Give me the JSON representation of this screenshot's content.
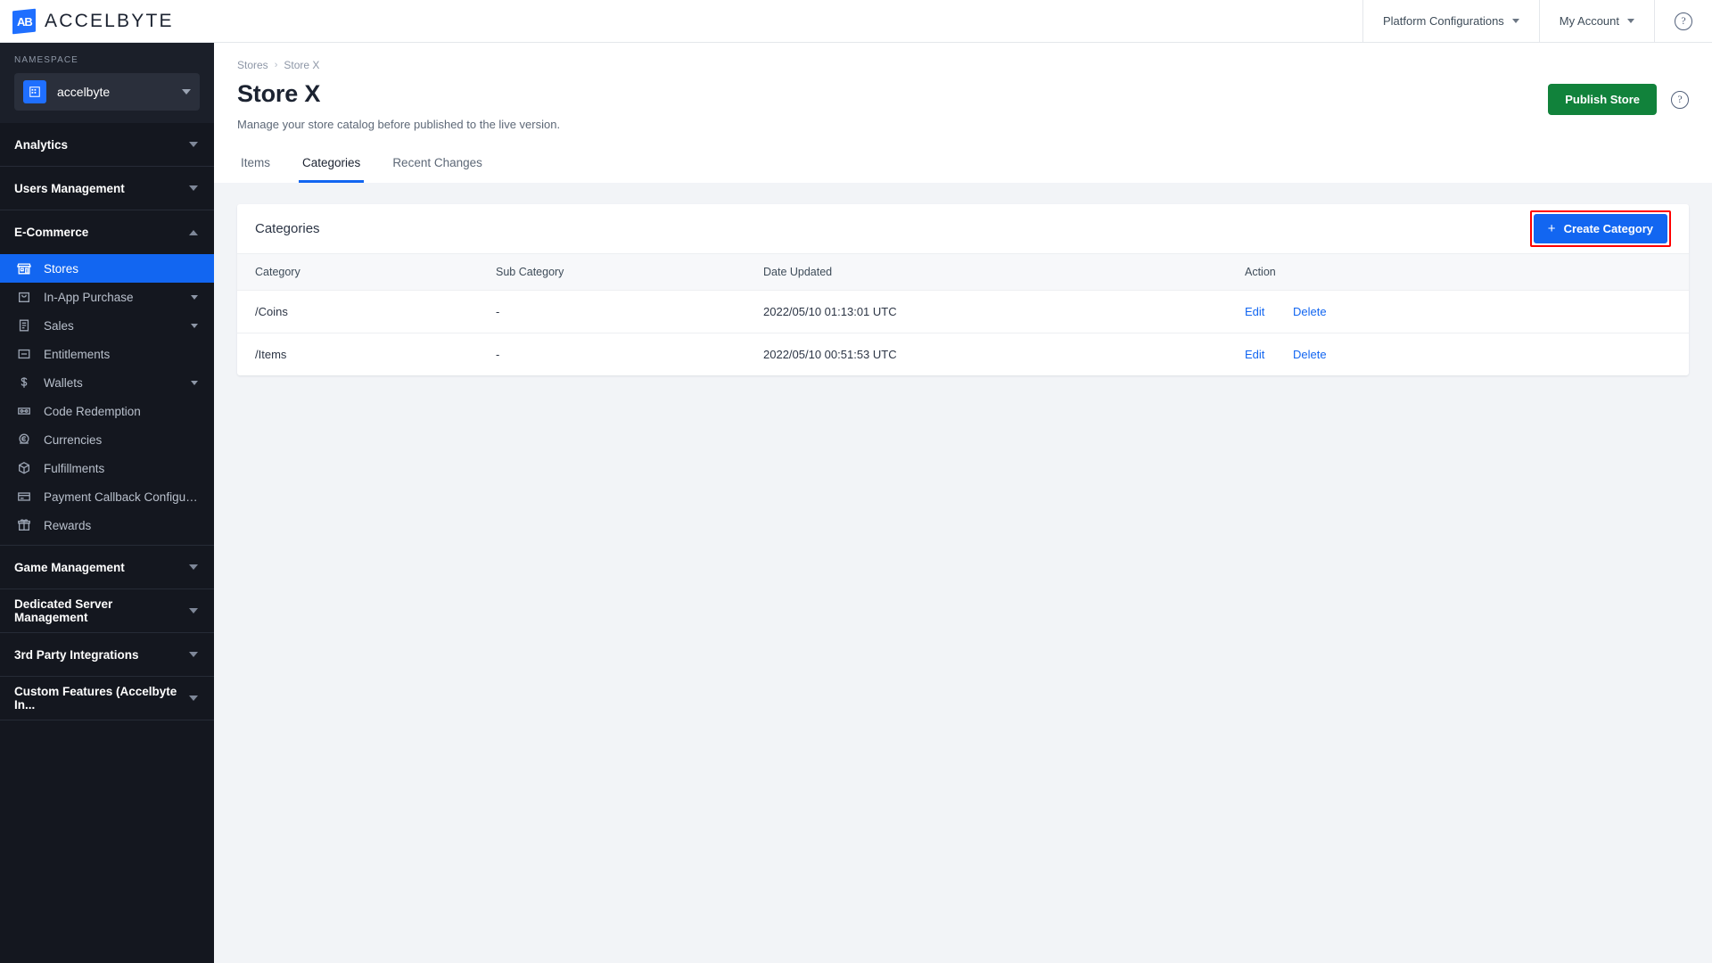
{
  "topbar": {
    "brand_mark": "AB",
    "brand_text": "ACCELBYTE",
    "platform_configurations": "Platform Configurations",
    "my_account": "My Account",
    "help_glyph": "?"
  },
  "sidebar": {
    "namespace_label": "NAMESPACE",
    "namespace_value": "accelbyte",
    "sections": [
      {
        "label": "Analytics",
        "expanded": false
      },
      {
        "label": "Users Management",
        "expanded": false
      },
      {
        "label": "E-Commerce",
        "expanded": true
      },
      {
        "label": "Game Management",
        "expanded": false
      },
      {
        "label": "Dedicated Server Management",
        "expanded": false
      },
      {
        "label": "3rd Party Integrations",
        "expanded": false
      },
      {
        "label": "Custom Features (Accelbyte In...",
        "expanded": false
      }
    ],
    "ecommerce_items": [
      {
        "label": "Stores",
        "icon": "store-icon",
        "active": true,
        "chevron": false
      },
      {
        "label": "In-App Purchase",
        "icon": "shopping-bag-icon",
        "active": false,
        "chevron": true
      },
      {
        "label": "Sales",
        "icon": "receipt-icon",
        "active": false,
        "chevron": true
      },
      {
        "label": "Entitlements",
        "icon": "card-icon",
        "active": false,
        "chevron": false
      },
      {
        "label": "Wallets",
        "icon": "dollar-icon",
        "active": false,
        "chevron": true
      },
      {
        "label": "Code Redemption",
        "icon": "ticket-icon",
        "active": false,
        "chevron": false
      },
      {
        "label": "Currencies",
        "icon": "coin-icon",
        "active": false,
        "chevron": false
      },
      {
        "label": "Fulfillments",
        "icon": "box-icon",
        "active": false,
        "chevron": false
      },
      {
        "label": "Payment Callback Configuration",
        "icon": "payment-card-icon",
        "active": false,
        "chevron": false
      },
      {
        "label": "Rewards",
        "icon": "gift-icon",
        "active": false,
        "chevron": false
      }
    ]
  },
  "page": {
    "breadcrumb": [
      "Stores",
      "Store X"
    ],
    "breadcrumb_separator": "›",
    "title": "Store X",
    "subtitle": "Manage your store catalog before published to the live version.",
    "publish_button": "Publish Store",
    "help_glyph": "?",
    "tabs": [
      {
        "label": "Items",
        "active": false
      },
      {
        "label": "Categories",
        "active": true
      },
      {
        "label": "Recent Changes",
        "active": false
      }
    ]
  },
  "categories_card": {
    "title": "Categories",
    "create_button": "Create Category",
    "create_button_plus": "+",
    "columns": [
      "Category",
      "Sub Category",
      "Date Updated",
      "Action"
    ],
    "rows": [
      {
        "category": "/Coins",
        "sub_category": "-",
        "date_updated": "2022/05/10 01:13:01 UTC",
        "edit": "Edit",
        "delete": "Delete"
      },
      {
        "category": "/Items",
        "sub_category": "-",
        "date_updated": "2022/05/10 00:51:53 UTC",
        "edit": "Edit",
        "delete": "Delete"
      }
    ]
  },
  "colors": {
    "accent_blue": "#1266f1",
    "publish_green": "#11823b",
    "highlight_red": "#ff0000",
    "sidebar_bg": "#14171f",
    "page_bg": "#f2f4f7"
  }
}
